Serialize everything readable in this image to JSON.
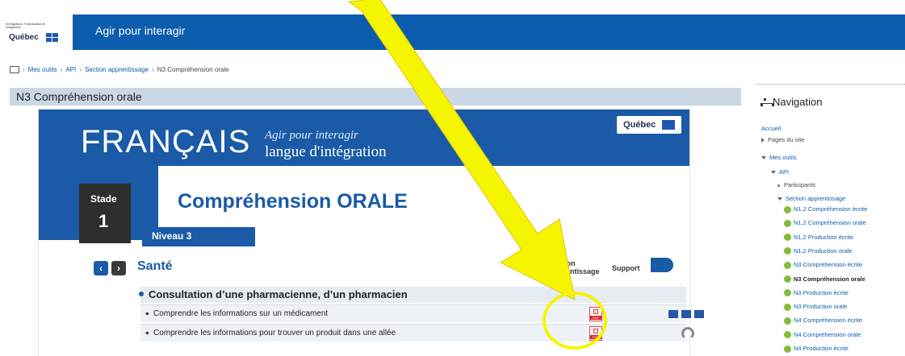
{
  "header": {
    "logo_lines": "Immigration, Francisation et Intégration",
    "logo_word": "Québec",
    "app_title": "Agir pour interagir"
  },
  "breadcrumb": {
    "items": [
      "Mes outils",
      "API",
      "Section apprentissage",
      "N3 Compréhension orale"
    ]
  },
  "page": {
    "title": "N3 Compréhension orale"
  },
  "content": {
    "brand": "Québec",
    "francais": "FRANÇAIS",
    "tagline_italic": "Agir pour interagir",
    "tagline_sub": "langue d'intégration",
    "stade_label": "Stade",
    "stade_number": "1",
    "heading": "Compréhension ORALE",
    "niveau": "Niveau 3",
    "topic": "Santé",
    "col_section": "Section Apprentissage",
    "col_support": "Support",
    "row_heading": "Consultation d’une pharmacienne, d’un pharmacien",
    "rows": [
      "Comprendre les informations sur un médicament",
      "Comprendre les informations pour trouver un produit dans une allée"
    ],
    "prev_icon": "chevron-left-icon",
    "next_icon": "chevron-right-icon"
  },
  "annotation": {
    "arrow_color": "#f5f500",
    "circle_color": "#f5f500"
  },
  "navigation": {
    "title": "Navigation",
    "home": "Accueil",
    "site_pages": "Pages du site",
    "my_tools": "Mes outils",
    "api": "API",
    "participants": "Participants",
    "section": "Section apprentissage",
    "items": [
      "N1,2 Compréhension écrite",
      "N1,2 Compréhension orale",
      "N1,2 Production écrite",
      "N1,2 Production orale",
      "N3 Compréhension écrite",
      "N3 Compréhension orale",
      "N3 Production écrite",
      "N3 Production orale",
      "N4 Compréhension écrite",
      "N4 Compréhension orale",
      "N4 Production écrite"
    ],
    "active_index": 5
  }
}
